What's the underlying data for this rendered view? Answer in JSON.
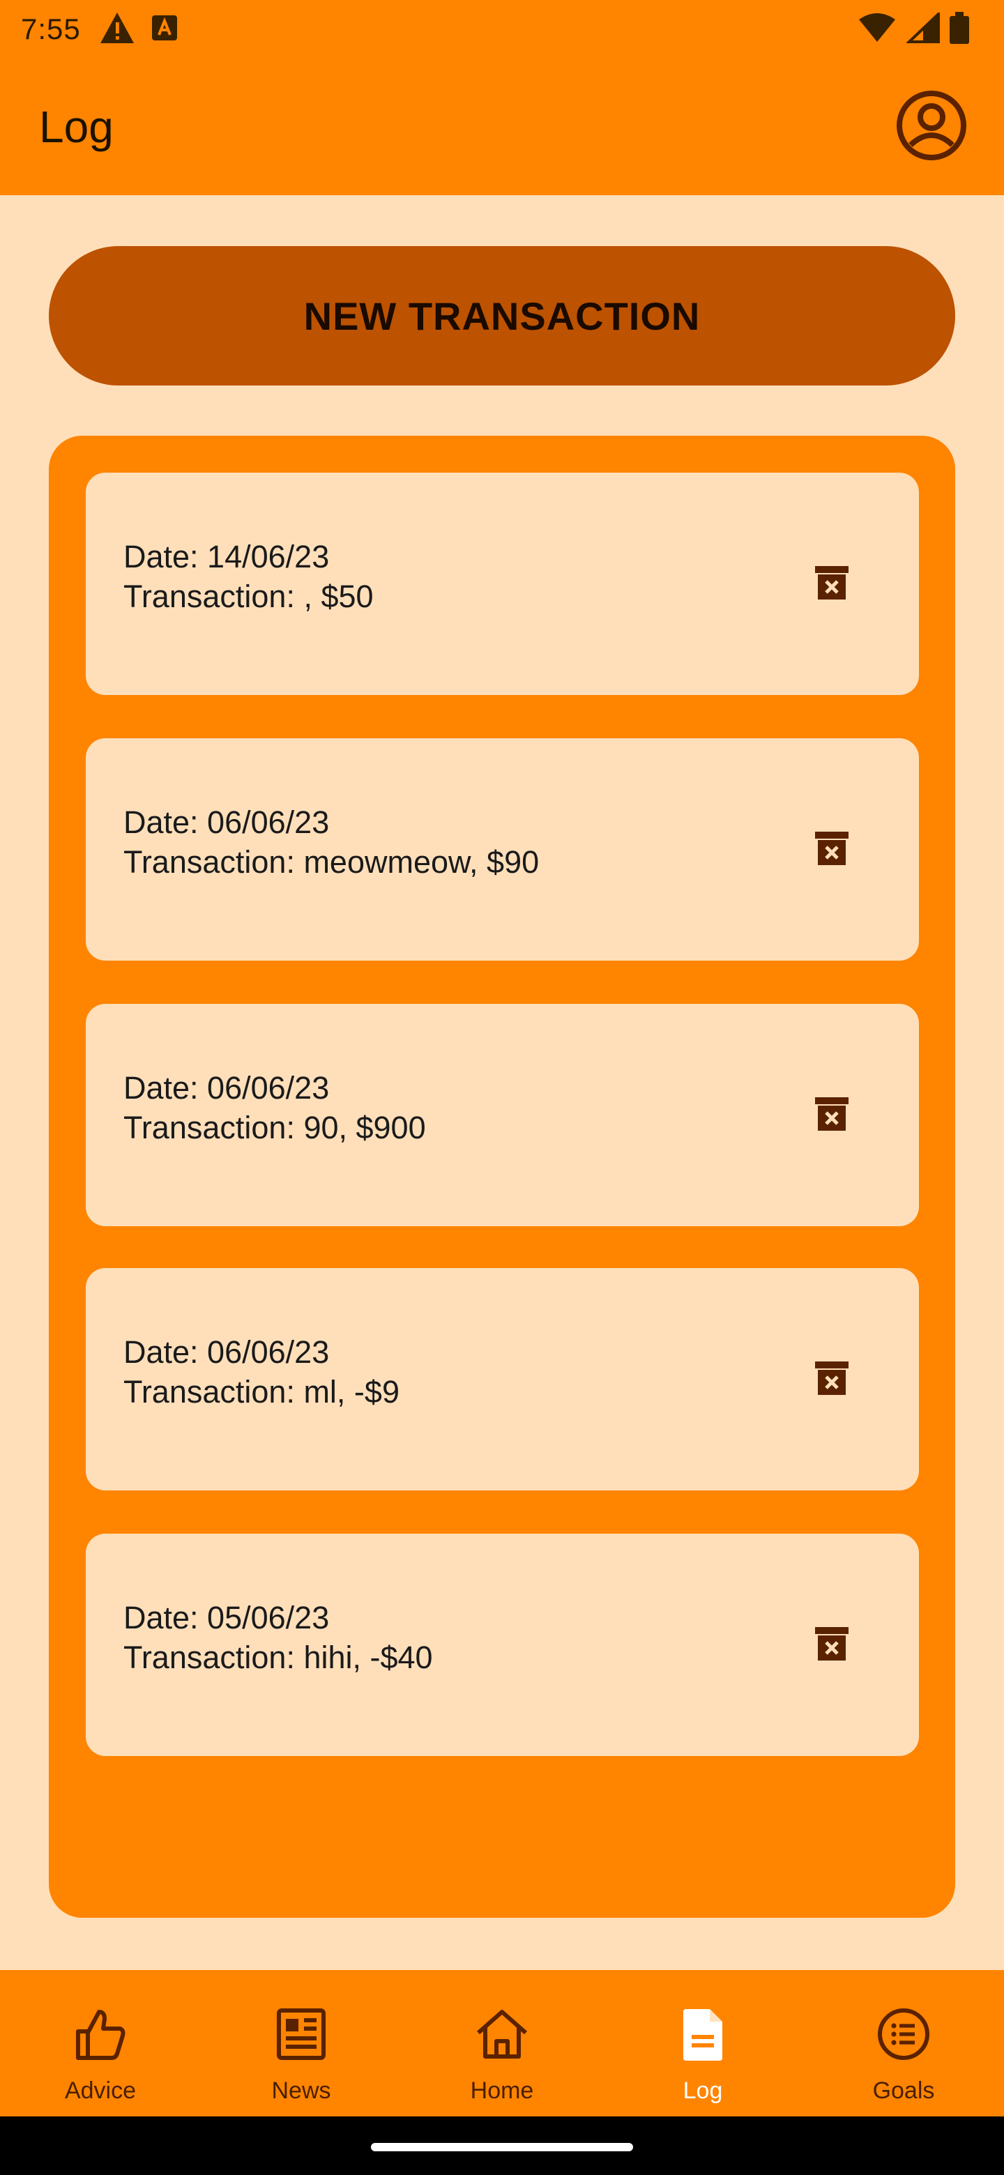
{
  "status_bar": {
    "time": "7:55",
    "left_icons": [
      "warning-icon",
      "keyboard-a-icon"
    ],
    "right_icons": [
      "wifi-icon",
      "signal-icon",
      "battery-icon"
    ]
  },
  "app_bar": {
    "title": "Log",
    "profile_icon": "account-circle-icon"
  },
  "new_transaction_label": "NEW TRANSACTION",
  "transactions": [
    {
      "date": "Date: 14/06/23",
      "transaction": "Transaction: , $50"
    },
    {
      "date": "Date: 06/06/23",
      "transaction": "Transaction: meowmeow, $90"
    },
    {
      "date": "Date: 06/06/23",
      "transaction": "Transaction: 90, $900"
    },
    {
      "date": "Date: 06/06/23",
      "transaction": "Transaction: ml, -$9"
    },
    {
      "date": "Date: 05/06/23",
      "transaction": "Transaction: hihi, -$40"
    }
  ],
  "bottom_nav": {
    "active": "Log",
    "items": [
      {
        "label": "Advice",
        "icon": "thumb-up-icon"
      },
      {
        "label": "News",
        "icon": "newspaper-icon"
      },
      {
        "label": "Home",
        "icon": "home-icon"
      },
      {
        "label": "Log",
        "icon": "document-icon"
      },
      {
        "label": "Goals",
        "icon": "list-circle-icon"
      }
    ]
  },
  "colors": {
    "primary": "#FF8400",
    "button": "#BD5200",
    "background": "#FFDFBA",
    "icon_dark": "#5A2200"
  }
}
